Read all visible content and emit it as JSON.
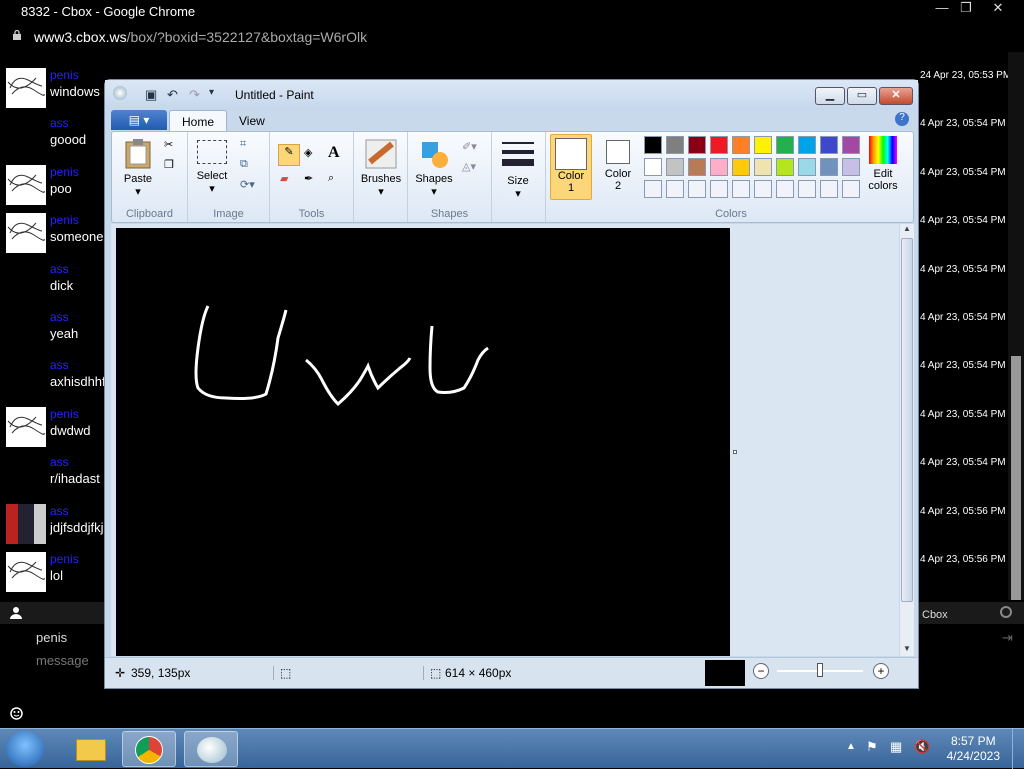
{
  "browser": {
    "title": "8332 - Cbox - Google Chrome",
    "url_host": "www3.cbox.ws",
    "url_path": "/box/?boxid=3522127&boxtag=W6rOlk",
    "minimize": "—",
    "restore": "❐",
    "close": "✕"
  },
  "chat": {
    "messages": [
      {
        "name": "penis",
        "text": "windows",
        "avatar": true,
        "time": "24 Apr 23, 05:53 PM"
      },
      {
        "name": "ass",
        "text": "goood",
        "avatar": false,
        "time": "4 Apr 23, 05:54 PM"
      },
      {
        "name": "penis",
        "text": "poo",
        "avatar": true,
        "time": "4 Apr 23, 05:54 PM"
      },
      {
        "name": "penis",
        "text": "someone",
        "avatar": true,
        "time": "4 Apr 23, 05:54 PM"
      },
      {
        "name": "ass",
        "text": "dick",
        "avatar": false,
        "time": "4 Apr 23, 05:54 PM"
      },
      {
        "name": "ass",
        "text": "yeah",
        "avatar": false,
        "time": "4 Apr 23, 05:54 PM"
      },
      {
        "name": "ass",
        "text": "axhisdhhf",
        "avatar": false,
        "time": "4 Apr 23, 05:54 PM"
      },
      {
        "name": "penis",
        "text": "dwdwd",
        "avatar": true,
        "time": "4 Apr 23, 05:54 PM"
      },
      {
        "name": "ass",
        "text": "r/ihadast",
        "avatar": false,
        "time": "4 Apr 23, 05:54 PM"
      },
      {
        "name": "ass",
        "text": "jdjfsddjfkj",
        "avatar": "photo",
        "time": "4 Apr 23, 05:56 PM"
      },
      {
        "name": "penis",
        "text": "lol",
        "avatar": true,
        "time": "4 Apr 23, 05:56 PM"
      }
    ],
    "input_name": "penis",
    "input_placeholder": "message",
    "brand": "Cbox",
    "user_icon": "person-icon",
    "emoji_icon": "smiley-icon"
  },
  "paint": {
    "title": "Untitled - Paint",
    "tabs": [
      "Home",
      "View"
    ],
    "groups": {
      "clipboard": "Clipboard",
      "image": "Image",
      "tools": "Tools",
      "shapes": "Shapes",
      "colors": "Colors"
    },
    "buttons": {
      "paste": "Paste",
      "select": "Select",
      "brushes": "Brushes",
      "shapes": "Shapes",
      "size": "Size",
      "color1_a": "Color",
      "color1_b": "1",
      "color2_a": "Color",
      "color2_b": "2",
      "edit_a": "Edit",
      "edit_b": "colors"
    },
    "palette_row1": [
      "#000000",
      "#7f7f7f",
      "#880015",
      "#ed1c24",
      "#ff7f27",
      "#fff200",
      "#22b14c",
      "#00a2e8",
      "#3f48cc",
      "#a349a4"
    ],
    "palette_row2": [
      "#ffffff",
      "#c3c3c3",
      "#b97a57",
      "#ffaec9",
      "#ffc90e",
      "#efe4b0",
      "#b5e61d",
      "#99d9ea",
      "#7092be",
      "#c8bfe7"
    ],
    "status": {
      "cursor": "359, 135px",
      "size": "614 × 460px"
    },
    "color1": "#ffffff",
    "color2": "#ffffff"
  },
  "taskbar": {
    "time": "8:57 PM",
    "date": "4/24/2023"
  }
}
